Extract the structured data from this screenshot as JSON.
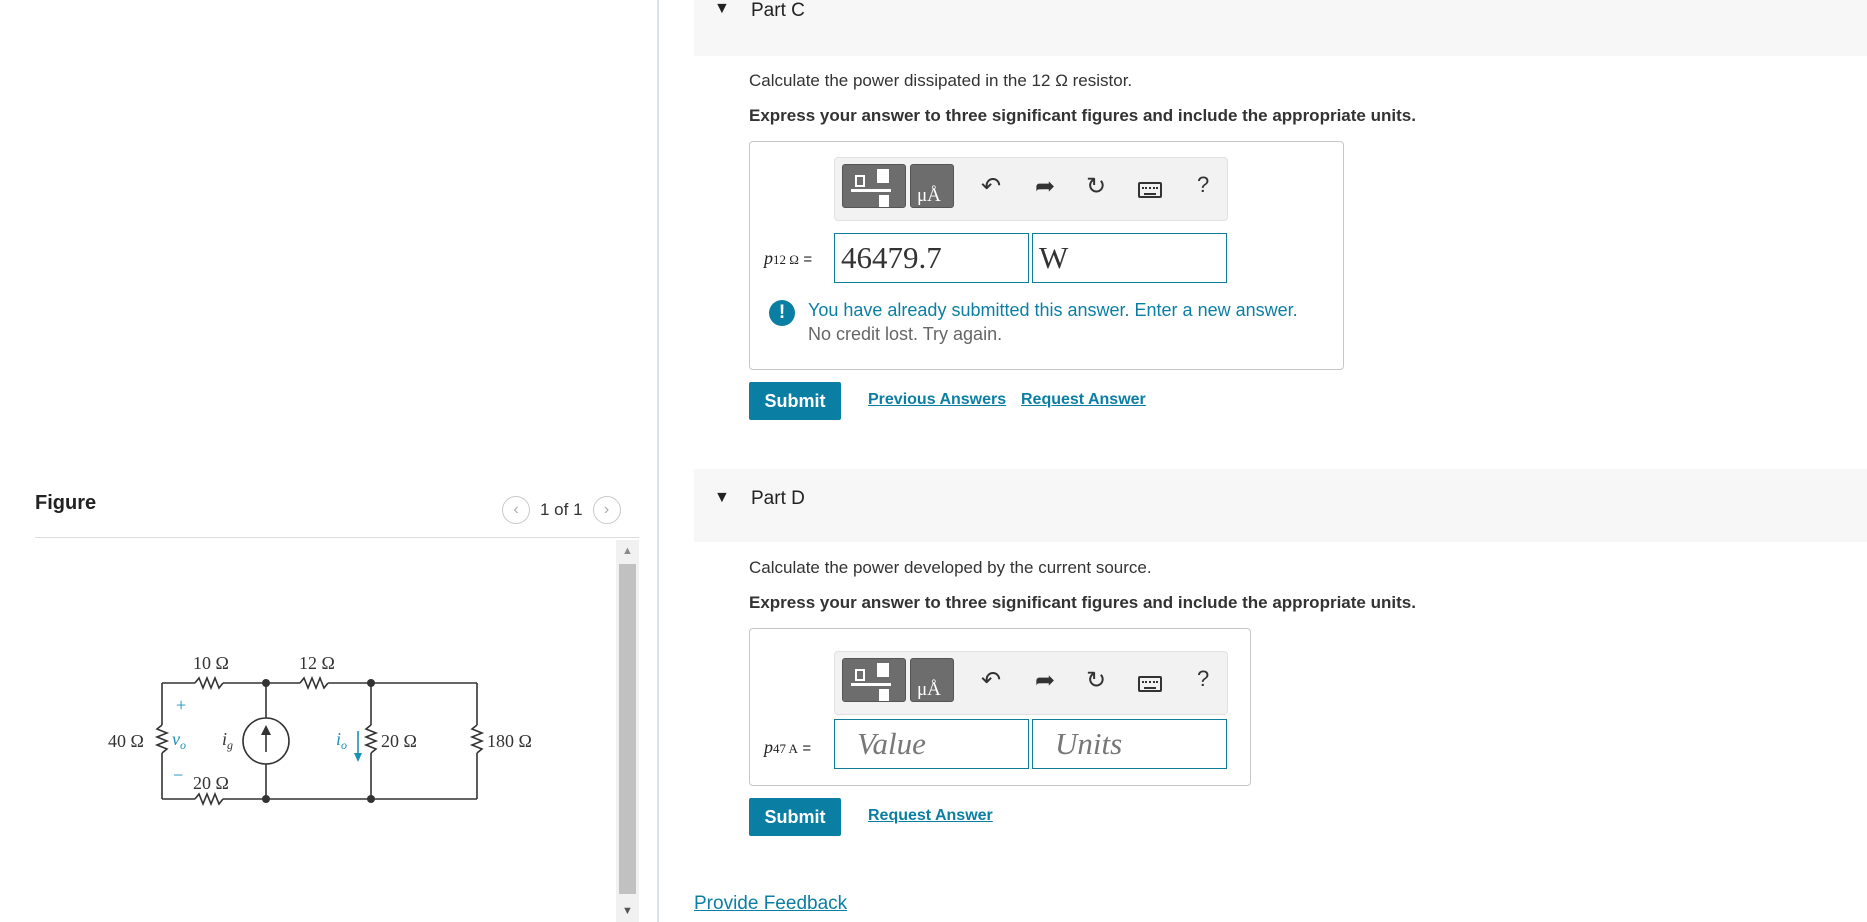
{
  "figure": {
    "title": "Figure",
    "pager": "1 of 1",
    "circuit_labels": {
      "r10": "10 Ω",
      "r12": "12 Ω",
      "r40": "40 Ω",
      "vo": "v",
      "vo_sub": "o",
      "ig": "i",
      "ig_sub": "g",
      "io": "i",
      "io_sub": "o",
      "r20_mid": "20 Ω",
      "r180": "180 Ω",
      "r20_bot": "20 Ω",
      "plus": "+",
      "minus": "−"
    }
  },
  "partC": {
    "title": "Part C",
    "question": "Calculate the power dissipated in the 12 Ω resistor.",
    "instruction": "Express your answer to three significant figures and include the appropriate units.",
    "var_main": "p",
    "var_sub": "12 Ω",
    "equals": "=",
    "value": "46479.7",
    "units": "W",
    "units_btn": "μÅ",
    "help": "?",
    "feedback_icon": "!",
    "feedback_msg": "You have already submitted this answer. Enter a new answer.",
    "feedback_sub": "No credit lost. Try again.",
    "submit": "Submit",
    "prev_answers": "Previous Answers",
    "request_answer": "Request Answer"
  },
  "partD": {
    "title": "Part D",
    "question": "Calculate the power developed by the current source.",
    "instruction": "Express your answer to three significant figures and include the appropriate units.",
    "var_main": "p",
    "var_sub": "47 A",
    "equals": "=",
    "value_placeholder": "Value",
    "units_placeholder": "Units",
    "units_btn": "μÅ",
    "help": "?",
    "submit": "Submit",
    "request_answer": "Request Answer"
  },
  "footer": {
    "provide_feedback": "Provide Feedback"
  },
  "icons": {
    "caret": "caret-down-icon",
    "undo": "undo-icon",
    "redo": "redo-icon",
    "reset": "reset-icon",
    "keyboard": "keyboard-icon",
    "warning": "exclamation-icon"
  },
  "colors": {
    "accent": "#0b7fa3",
    "header_bg": "#f7f7f7"
  }
}
